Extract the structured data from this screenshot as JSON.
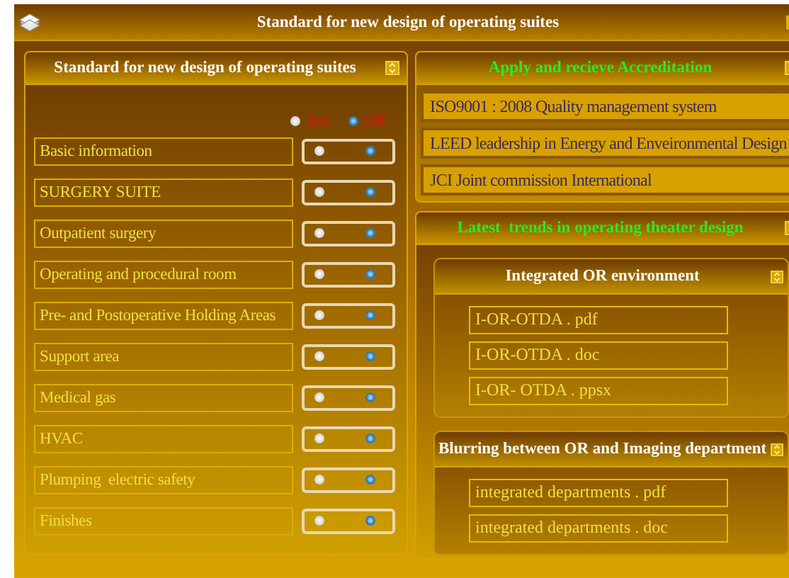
{
  "window": {
    "title": "Standard for new design of operating suites"
  },
  "standards_panel": {
    "title": "Standard for new design of operating suites",
    "legend": [
      {
        "label": "doc",
        "selected": false
      },
      {
        "label": "pdf",
        "selected": true
      }
    ],
    "rows": [
      {
        "label": "Basic information",
        "options": [
          {
            "selected": false
          },
          {
            "selected": true
          }
        ]
      },
      {
        "label": "SURGERY SUITE",
        "options": [
          {
            "selected": false
          },
          {
            "selected": true
          }
        ]
      },
      {
        "label": "Outpatient surgery",
        "options": [
          {
            "selected": false
          },
          {
            "selected": true
          }
        ]
      },
      {
        "label": "Operating and procedural room",
        "options": [
          {
            "selected": false
          },
          {
            "selected": true
          }
        ]
      },
      {
        "label": "Pre- and Postoperative Holding Areas",
        "options": [
          {
            "selected": false
          },
          {
            "selected": true
          }
        ]
      },
      {
        "label": "Support area",
        "options": [
          {
            "selected": false
          },
          {
            "selected": true
          }
        ]
      },
      {
        "label": "Medical gas",
        "options": [
          {
            "selected": false
          },
          {
            "selected": true
          }
        ]
      },
      {
        "label": "HVAC",
        "options": [
          {
            "selected": false
          },
          {
            "selected": true
          }
        ]
      },
      {
        "label": "Plumping  electric safety",
        "options": [
          {
            "selected": false
          },
          {
            "selected": true
          }
        ]
      },
      {
        "label": "Finishes",
        "options": [
          {
            "selected": false
          },
          {
            "selected": true
          }
        ]
      }
    ]
  },
  "accreditation_panel": {
    "title": "Apply and recieve Accreditation",
    "items": [
      "ISO9001 : 2008 Quality management system",
      "LEED leadership in Energy and Enveironmental Design",
      "JCI Joint commission International"
    ]
  },
  "trends_panel": {
    "title": "Latest  trends in operating theater design",
    "sections": [
      {
        "title": "Integrated OR environment",
        "files": [
          "I-OR-OTDA . pdf",
          "I-OR-OTDA . doc",
          "I-OR- OTDA . ppsx"
        ]
      },
      {
        "title": "Blurring between OR and Imaging department",
        "files": [
          "integrated departments . pdf",
          "integrated departments . doc"
        ]
      }
    ]
  }
}
